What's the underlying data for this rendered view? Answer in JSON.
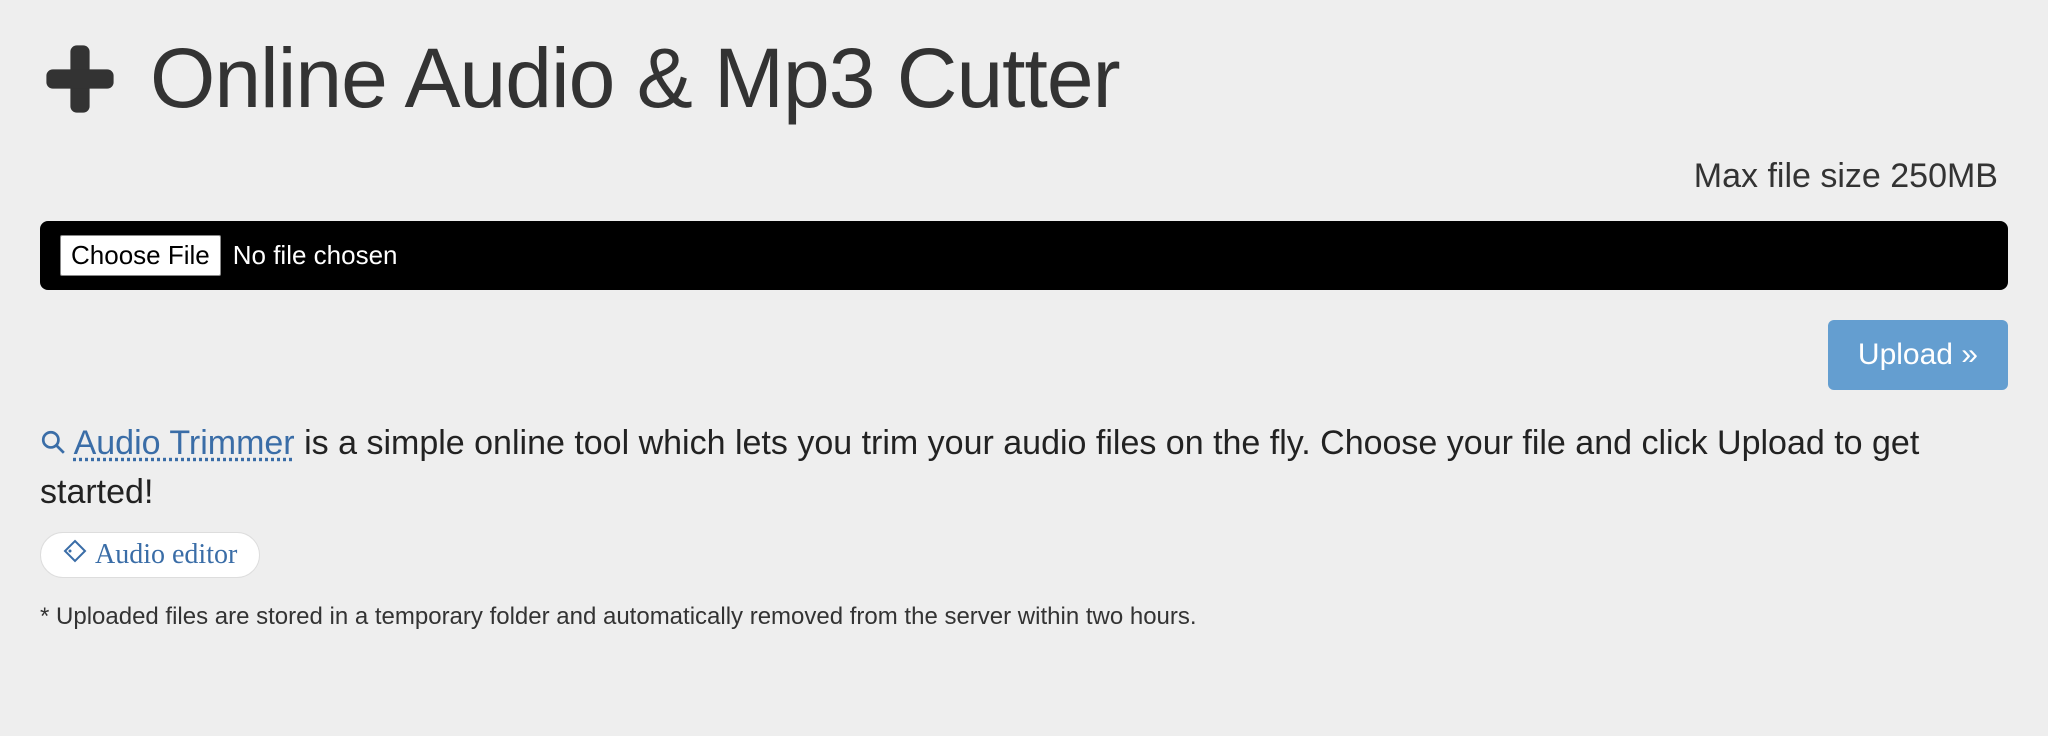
{
  "header": {
    "title": "Online Audio & Mp3 Cutter"
  },
  "info": {
    "max_file_size": "Max file size 250MB"
  },
  "file_input": {
    "choose_label": "Choose File",
    "status": "No file chosen"
  },
  "actions": {
    "upload_label": "Upload »"
  },
  "description": {
    "link_text": "Audio Trimmer",
    "rest_text": " is a simple online tool which lets you trim your audio files on the fly. Choose your file and click Upload to get started!"
  },
  "tag": {
    "label": "Audio editor"
  },
  "footnote": {
    "text": "* Uploaded files are stored in a temporary folder and automatically removed from the server within two hours."
  }
}
